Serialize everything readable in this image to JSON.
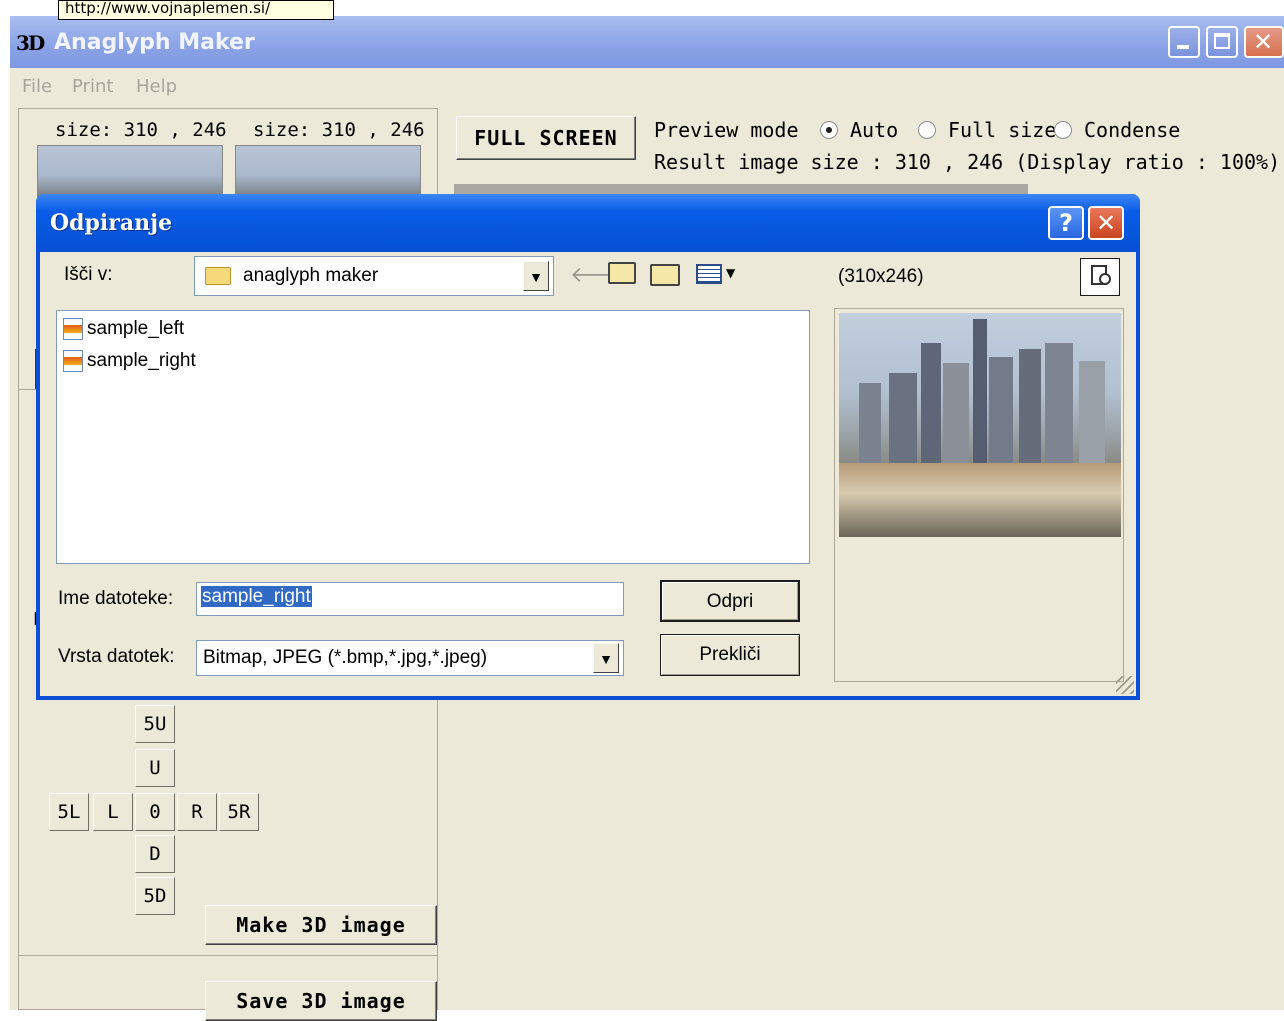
{
  "tooltip": "http://www.vojnaplemen.si/",
  "main": {
    "title": "Anaglyph Maker",
    "icon": "3D",
    "menu": [
      "File",
      "Print",
      "Help"
    ],
    "left_size": "size: 310 , 246",
    "right_size": "size: 310 , 246",
    "full_screen": "FULL SCREEN",
    "preview_mode": "Preview mode",
    "modes": [
      "Auto",
      "Full size",
      "Condense"
    ],
    "selected_mode": "Auto",
    "result_size": "Result image size :  310 , 246  (Display ratio : 100%)",
    "partial_label": "B",
    "shift_buttons": {
      "up5": "5U",
      "up": "U",
      "left5": "5L",
      "left": "L",
      "center": "0",
      "right": "R",
      "right5": "5R",
      "down": "D",
      "down5": "5D"
    },
    "make_btn": "Make 3D image",
    "save_btn": "Save 3D image"
  },
  "dialog": {
    "title": "Odpiranje",
    "help": "?",
    "close": "✕",
    "look_in_label": "Išči v:",
    "look_in_value": "anaglyph maker",
    "dimensions": "(310x246)",
    "files": [
      "sample_left",
      "sample_right"
    ],
    "filename_label": "Ime datoteke:",
    "filename_value": "sample_right",
    "filetype_label": "Vrsta datotek:",
    "filetype_value": "Bitmap, JPEG (*.bmp,*.jpg,*.jpeg)",
    "open_btn": "Odpri",
    "cancel_btn": "Prekliči"
  },
  "icons": [
    "folder-icon",
    "back-icon",
    "up-folder-icon",
    "new-folder-icon",
    "view-menu-icon",
    "preview-icon",
    "file-image-icon",
    "minimize-icon",
    "maximize-icon",
    "close-icon",
    "help-icon",
    "dropdown-arrow-icon"
  ]
}
